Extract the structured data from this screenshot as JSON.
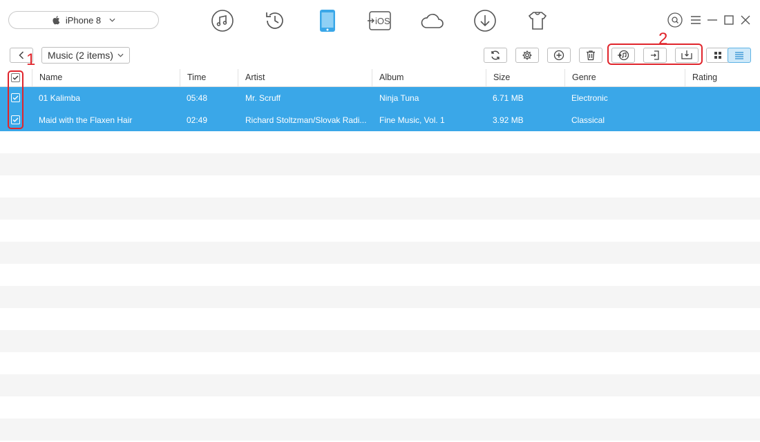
{
  "device": {
    "name": "iPhone 8"
  },
  "nav": {
    "items": [
      "music-icon",
      "history-icon",
      "phone-icon",
      "to-ios-icon",
      "cloud-icon",
      "download-icon",
      "shirt-icon"
    ],
    "to_ios_label": "iOS",
    "active": "phone-icon",
    "accent": "#3aa7e8"
  },
  "window_controls": [
    "search-icon",
    "menu-icon",
    "minimize-icon",
    "maximize-icon",
    "close-icon"
  ],
  "toolbar": {
    "category_label": "Music (2 items)",
    "buttons": [
      "refresh-icon",
      "settings-icon",
      "add-icon",
      "delete-icon",
      "to-itunes-icon",
      "to-device-icon",
      "to-computer-icon",
      "grid-view-icon",
      "list-view-icon"
    ],
    "active_view": "list-view-icon"
  },
  "annotations": {
    "label_1": "1",
    "label_2": "2",
    "color": "#e0242b"
  },
  "table": {
    "columns": [
      "Name",
      "Time",
      "Artist",
      "Album",
      "Size",
      "Genre",
      "Rating"
    ],
    "rows": [
      {
        "name": "01 Kalimba",
        "time": "05:48",
        "artist": "Mr. Scruff",
        "album": "Ninja Tuna",
        "size": "6.71 MB",
        "genre": "Electronic",
        "rating": "",
        "checked": true
      },
      {
        "name": "Maid with the Flaxen Hair",
        "time": "02:49",
        "artist": "Richard Stoltzman/Slovak Radi...",
        "album": "Fine Music, Vol. 1",
        "size": "3.92 MB",
        "genre": "Classical",
        "rating": "",
        "checked": true
      }
    ],
    "selection_color": "#3aa7e8",
    "all_checked": true
  }
}
